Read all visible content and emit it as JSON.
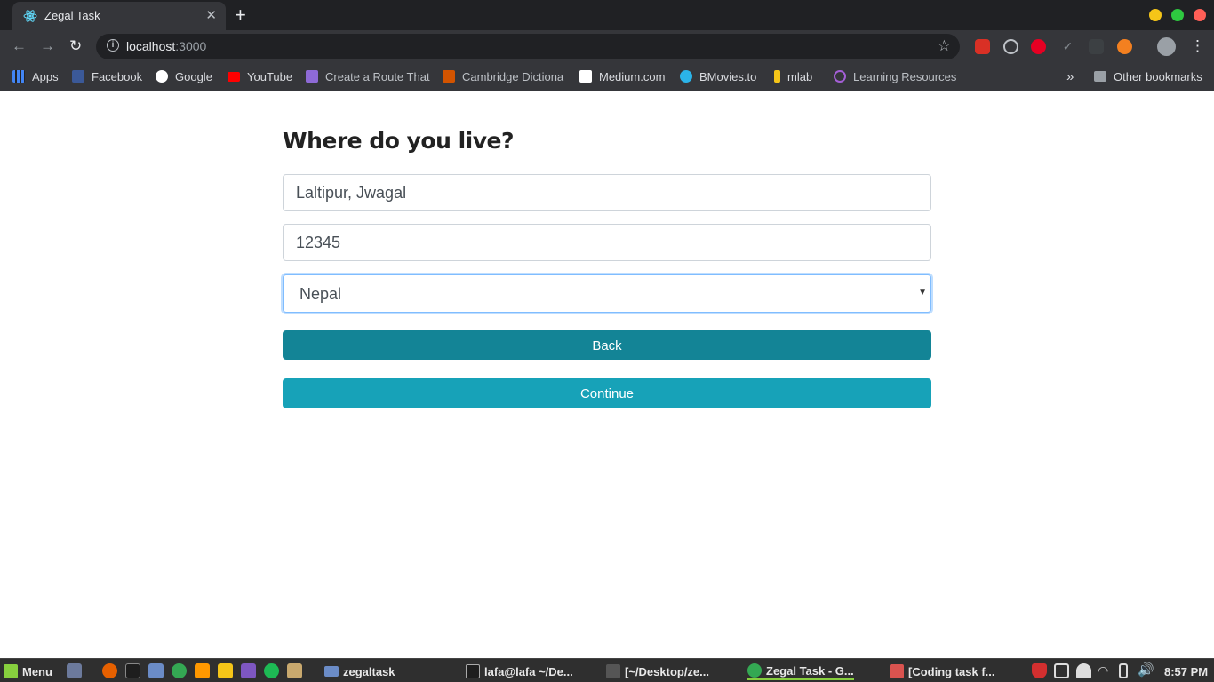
{
  "browser": {
    "tab_title": "Zegal Task",
    "tab_close": "✕",
    "new_tab": "+",
    "url_host": "localhost",
    "url_port": ":3000",
    "info_glyph": "i",
    "star_glyph": "☆",
    "bookmarks": [
      {
        "label": "Apps",
        "icon": "apps-grid-icon",
        "color": "#4285f4"
      },
      {
        "label": "Facebook",
        "icon": "facebook-icon",
        "color": "#3b5998"
      },
      {
        "label": "Google",
        "icon": "google-icon",
        "color": "#ffffff"
      },
      {
        "label": "YouTube",
        "icon": "youtube-icon",
        "color": "#ff0000"
      },
      {
        "label": "Create a Route That",
        "icon": "cloud-icon",
        "color": "#8e6ad6"
      },
      {
        "label": "Cambridge Dictiona",
        "icon": "cambridge-icon",
        "color": "#d35400"
      },
      {
        "label": "Medium.com",
        "icon": "medium-icon",
        "color": "#ffffff"
      },
      {
        "label": "BMovies.to",
        "icon": "play-icon",
        "color": "#2bb3e8"
      },
      {
        "label": "mlab",
        "icon": "mlab-icon",
        "color": "#f5c518"
      },
      {
        "label": "Learning Resources",
        "icon": "graphql-icon",
        "color": "#a45fd6"
      }
    ],
    "more_bookmarks": "»",
    "other_bookmarks": "Other bookmarks"
  },
  "page": {
    "heading": "Where do you live?",
    "address_value": "Laltipur, Jwagal",
    "zip_value": "12345",
    "country_value": "Nepal",
    "back_label": "Back",
    "continue_label": "Continue",
    "back_color": "#138496",
    "continue_color": "#17a2b8"
  },
  "taskbar": {
    "menu_label": "Menu",
    "windows": [
      {
        "label": "zegaltask",
        "icon": "folder-icon"
      },
      {
        "label": "lafa@lafa ~/De...",
        "icon": "terminal-icon"
      },
      {
        "label": "[~/Desktop/ze...",
        "icon": "sublime-icon"
      },
      {
        "label": "Zegal Task - G...",
        "icon": "chrome-icon"
      },
      {
        "label": "[Coding task f...",
        "icon": "document-icon"
      }
    ],
    "clock": "8:57 PM"
  }
}
